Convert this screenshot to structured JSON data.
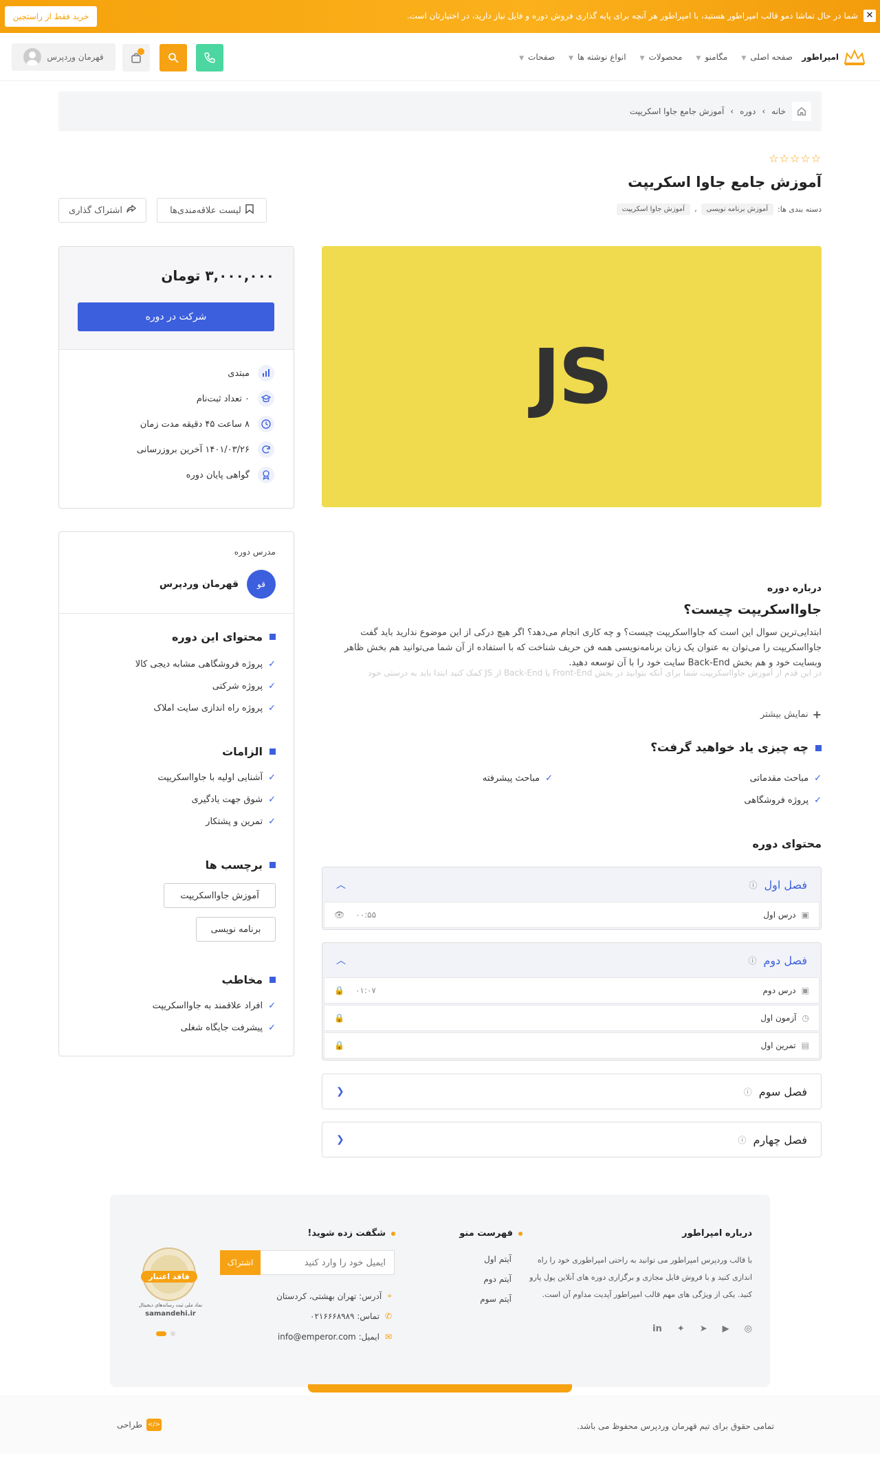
{
  "topbar": {
    "message": "شما در حال تماشا دمو قالب امپراطور هستید، با امپراطور هر آنچه برای پایه گذاری فروش دوره و فایل نیاز دارید، در اختیارتان است.",
    "buy_label": "خرید فقط از راستچین",
    "close": "✕"
  },
  "header": {
    "logo_text": "امپراطور",
    "nav": [
      "صفحه اصلی",
      "مگامنو",
      "محصولات",
      "انواع نوشته ها",
      "صفحات"
    ],
    "user_name": "قهرمان وردپرس"
  },
  "breadcrumb": {
    "items": [
      "خانه",
      "دوره",
      "آموزش جامع جاوا اسکریپت"
    ],
    "sep": "›"
  },
  "course": {
    "stars": "☆☆☆☆☆",
    "title": "آموزش جامع جاوا اسکریپت",
    "cats_label": "دسته بندی ها:",
    "cats": [
      "آموزش برنامه نویسی",
      "آموزش جاوا اسکریپت"
    ],
    "cat_sep": "،",
    "wishlist_label": "لیست علاقه‌مندی‌ها",
    "share_label": "اشتراک گذاری",
    "media_text": "JS"
  },
  "price_box": {
    "price": "۳,۰۰۰,۰۰۰ تومان",
    "enroll_label": "شرکت در دوره",
    "info": [
      {
        "icon": "level-icon",
        "text": "مبتدی"
      },
      {
        "icon": "students-icon",
        "text": "۰ تعداد ثبت‌نام"
      },
      {
        "icon": "clock-icon",
        "text": "۸ ساعت ۴۵ دقیقه مدت زمان"
      },
      {
        "icon": "update-icon",
        "text": "۱۴۰۱/۰۳/۲۶ آخرین بروزرسانی"
      },
      {
        "icon": "certificate-icon",
        "text": "گواهی پایان دوره"
      }
    ]
  },
  "teacher_box": {
    "label": "مدرس دوره",
    "avatar_text": "قو",
    "name": "قهرمان وردپرس",
    "content_h": "محتوای این دوره",
    "content_items": [
      "پروژه فروشگاهی مشابه دیجی کالا",
      "پروژه شرکتی",
      "پروژه راه اندازی سایت املاک"
    ],
    "req_h": "الزامات",
    "req_items": [
      "آشنایی اولیه با جاوااسکریپت",
      "شوق جهت یادگیری",
      "تمرین و پشتکار"
    ],
    "tags_h": "برچسب ها",
    "tags": [
      "آموزش جاوااسکریپت",
      "برنامه نویسی"
    ],
    "aud_h": "مخاطب",
    "aud_items": [
      "افراد علاقمند به جاوااسکریپت",
      "پیشرفت جایگاه شغلی"
    ]
  },
  "about": {
    "title": "درباره دوره",
    "heading": "جاوااسکریپت چیست؟",
    "paragraph": "ابتدایی‌ترین سوال این است که جاوااسکریپت چیست؟ و چه کاری انجام می‌دهد؟ اگر هیچ درکی از این موضوع ندارید باید گفت جاوااسکریپت را می‌توان به عنوان یک زبان برنامه‌نویسی همه فن حریف شناخت که با استفاده از آن شما می‌توانید هم بخش ظاهر وبسایت خود و هم بخش Back-End سایت خود را با آن توسعه دهید.",
    "fade_text": "در این قدم از آموزش جاوااسکریپت شما برای آنکه بتوانید در بخش Front-End یا Back-End از JS کمک کنید ابتدا باید به درستی خود",
    "more_label": "نمایش بیشتر"
  },
  "learn": {
    "heading": "چه چیزی یاد خواهید گرفت؟",
    "items": [
      "مباحث مقدماتی",
      "مباحث پیشرفته",
      "پروژه فروشگاهی"
    ]
  },
  "curriculum": {
    "heading": "محتوای دوره",
    "chapters": [
      {
        "title": "فصل اول",
        "lessons": [
          {
            "title": "درس اول",
            "time": "۰۰:۵۵"
          }
        ]
      },
      {
        "title": "فصل دوم",
        "lessons": [
          {
            "title": "درس دوم",
            "time": "۰۱:۰۷"
          },
          {
            "title": "آزمون اول",
            "time": ""
          },
          {
            "title": "تمرین اول",
            "time": ""
          }
        ]
      },
      {
        "title": "فصل سوم"
      },
      {
        "title": "فصل چهارم"
      }
    ]
  },
  "footer": {
    "about_h": "درباره امپراطور",
    "about_text": "با قالب وردپرس امپراطور  می توانید به راحتی امپراطوری خود را راه اندازی کنید و با فروش  فایل مجازی و برگزاری دوره های آنلاین پول پارو کنید. یکی از ویژگی های مهم قالب امپراطور آپدیت مداوم آن است.",
    "menu_h": "فهرست منو",
    "menu_items": [
      "آیتم اول",
      "آیتم دوم",
      "آیتم سوم"
    ],
    "news_h": "شگفت زده شوید!",
    "email_placeholder": "ایمیل خود را وارد کنید",
    "subscribe_label": "اشتراک",
    "address": "آدرس: تهران بهشتی، کردستان",
    "phone": "تماس: ۰۲۱۶۶۶۸۹۸۹",
    "email": "ایمیل: info@emperor.com",
    "seal_title": "فاقد اعتبار",
    "seal_sub": "samandehi.ir",
    "seal_caption": "نماد ملی ثبت رسانه‌های دیجیتال",
    "copyright": "تمامی حقوق برای تیم قهرمان وردپرس محفوظ می باشد.",
    "designer": "طراحی",
    "designer_badge": "</>"
  },
  "colors": {
    "accent": "#f7a212",
    "primary": "#3c5fde",
    "js_yellow": "#f0db4f"
  }
}
